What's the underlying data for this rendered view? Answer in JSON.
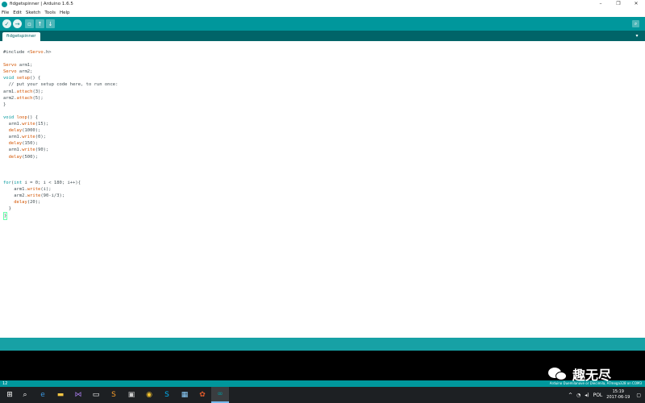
{
  "window": {
    "title": "fidgetspinner | Arduino 1.6.5",
    "controls": {
      "minimize": "–",
      "maximize": "❐",
      "close": "✕"
    }
  },
  "menu": {
    "items": [
      "File",
      "Edit",
      "Sketch",
      "Tools",
      "Help"
    ]
  },
  "toolbar": {
    "verify_icon": "✓",
    "upload_icon": "→",
    "new_icon": "▫",
    "open_icon": "↑",
    "save_icon": "↓",
    "serial_monitor_icon": "⌕"
  },
  "tabs": {
    "active": "fidgetspinner",
    "menu_icon": "▾"
  },
  "editor": {
    "lines": [
      [
        {
          "t": "#include <",
          "c": ""
        },
        {
          "t": "Servo",
          "c": "kw-orange"
        },
        {
          "t": ".h>",
          "c": ""
        }
      ],
      [
        {
          "t": "",
          "c": ""
        }
      ],
      [
        {
          "t": "Servo",
          "c": "kw-orange"
        },
        {
          "t": " arm1;",
          "c": ""
        }
      ],
      [
        {
          "t": "Servo",
          "c": "kw-orange"
        },
        {
          "t": " arm2;",
          "c": ""
        }
      ],
      [
        {
          "t": "void",
          "c": "kw-blue"
        },
        {
          "t": " ",
          "c": ""
        },
        {
          "t": "setup",
          "c": "kw-orange"
        },
        {
          "t": "() {",
          "c": ""
        }
      ],
      [
        {
          "t": "  // put your setup code here, to run once:",
          "c": ""
        }
      ],
      [
        {
          "t": "arm1.",
          "c": ""
        },
        {
          "t": "attach",
          "c": "kw-orange"
        },
        {
          "t": "(3);",
          "c": ""
        }
      ],
      [
        {
          "t": "arm2.",
          "c": ""
        },
        {
          "t": "attach",
          "c": "kw-orange"
        },
        {
          "t": "(5);",
          "c": ""
        }
      ],
      [
        {
          "t": "}",
          "c": ""
        }
      ],
      [
        {
          "t": "",
          "c": ""
        }
      ],
      [
        {
          "t": "void",
          "c": "kw-blue"
        },
        {
          "t": " ",
          "c": ""
        },
        {
          "t": "loop",
          "c": "kw-orange"
        },
        {
          "t": "() {",
          "c": ""
        }
      ],
      [
        {
          "t": "  arm1.",
          "c": ""
        },
        {
          "t": "write",
          "c": "kw-orange"
        },
        {
          "t": "(15);",
          "c": ""
        }
      ],
      [
        {
          "t": "  ",
          "c": ""
        },
        {
          "t": "delay",
          "c": "kw-orange"
        },
        {
          "t": "(1000);",
          "c": ""
        }
      ],
      [
        {
          "t": "  arm1.",
          "c": ""
        },
        {
          "t": "write",
          "c": "kw-orange"
        },
        {
          "t": "(0);",
          "c": ""
        }
      ],
      [
        {
          "t": "  ",
          "c": ""
        },
        {
          "t": "delay",
          "c": "kw-orange"
        },
        {
          "t": "(150);",
          "c": ""
        }
      ],
      [
        {
          "t": "  arm1.",
          "c": ""
        },
        {
          "t": "write",
          "c": "kw-orange"
        },
        {
          "t": "(90);",
          "c": ""
        }
      ],
      [
        {
          "t": "  ",
          "c": ""
        },
        {
          "t": "delay",
          "c": "kw-orange"
        },
        {
          "t": "(500);",
          "c": ""
        }
      ],
      [
        {
          "t": "",
          "c": ""
        }
      ],
      [
        {
          "t": "",
          "c": ""
        }
      ],
      [
        {
          "t": "",
          "c": ""
        }
      ],
      [
        {
          "t": "for",
          "c": "kw-blue"
        },
        {
          "t": "(",
          "c": ""
        },
        {
          "t": "int",
          "c": "kw-blue"
        },
        {
          "t": " i = 0; i < 180; i++){",
          "c": ""
        }
      ],
      [
        {
          "t": "    arm1.",
          "c": ""
        },
        {
          "t": "write",
          "c": "kw-orange"
        },
        {
          "t": "(i);",
          "c": ""
        }
      ],
      [
        {
          "t": "    arm2.",
          "c": ""
        },
        {
          "t": "write",
          "c": "kw-orange"
        },
        {
          "t": "(90-i/3);",
          "c": ""
        }
      ],
      [
        {
          "t": "    ",
          "c": ""
        },
        {
          "t": "delay",
          "c": "kw-orange"
        },
        {
          "t": "(20);",
          "c": ""
        }
      ],
      [
        {
          "t": "  }",
          "c": ""
        }
      ],
      [
        {
          "t": "}",
          "c": "cursor"
        }
      ]
    ]
  },
  "status": {
    "line_number": "12",
    "board": "Arduino Duemilanove or Diecimila, ATmega328 on COM3"
  },
  "taskbar": {
    "start_icon": "⊞",
    "apps": [
      {
        "name": "search",
        "glyph": "⌕",
        "color": "#ffffff"
      },
      {
        "name": "edge",
        "glyph": "e",
        "color": "#3a96dd"
      },
      {
        "name": "file-explorer",
        "glyph": "▬",
        "color": "#f6c744"
      },
      {
        "name": "visual-studio",
        "glyph": "⋈",
        "color": "#a177e0"
      },
      {
        "name": "notepad",
        "glyph": "▭",
        "color": "#ffffff"
      },
      {
        "name": "sublime",
        "glyph": "S",
        "color": "#f59b2a"
      },
      {
        "name": "terminal",
        "glyph": "▣",
        "color": "#cccccc"
      },
      {
        "name": "chrome",
        "glyph": "◉",
        "color": "#f2c12e"
      },
      {
        "name": "skype",
        "glyph": "S",
        "color": "#00aff0"
      },
      {
        "name": "photos",
        "glyph": "▦",
        "color": "#8fd1ff"
      },
      {
        "name": "fruit",
        "glyph": "✿",
        "color": "#e25b2b"
      },
      {
        "name": "arduino",
        "glyph": "∞",
        "color": "#00979c"
      }
    ],
    "tray": {
      "chevron": "^",
      "wifi_icon": "◔",
      "volume_icon": "◂)",
      "lang": "POL",
      "time": "15:19",
      "date": "2017-06-19",
      "notification_icon": "▢"
    }
  },
  "watermark": {
    "text": "趣无尽"
  }
}
